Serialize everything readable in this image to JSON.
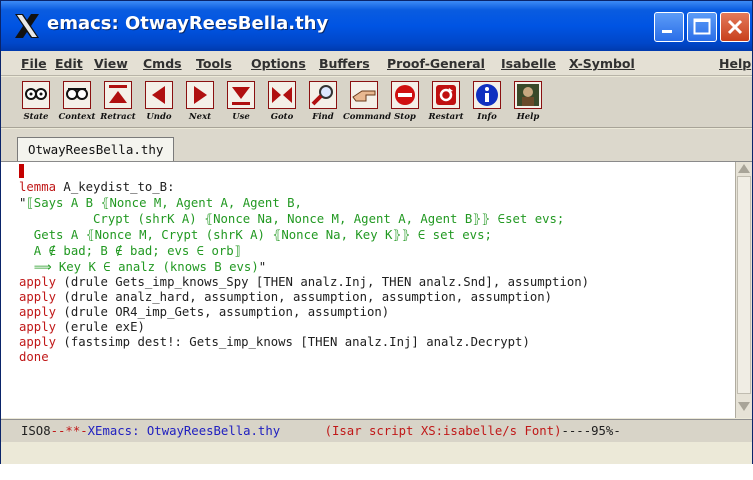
{
  "window": {
    "title": "emacs: OtwayReesBella.thy"
  },
  "menubar": {
    "items": [
      "File",
      "Edit",
      "View",
      "Cmds",
      "Tools",
      "Options",
      "Buffers",
      "Proof-General",
      "Isabelle",
      "X-Symbol"
    ],
    "help": "Help"
  },
  "toolbar": {
    "buttons": [
      {
        "label": "State",
        "icon": "glasses-icon"
      },
      {
        "label": "Context",
        "icon": "glasses-icon"
      },
      {
        "label": "Retract",
        "icon": "retract-icon"
      },
      {
        "label": "Undo",
        "icon": "undo-icon"
      },
      {
        "label": "Next",
        "icon": "next-icon"
      },
      {
        "label": "Use",
        "icon": "use-icon"
      },
      {
        "label": "Goto",
        "icon": "goto-icon"
      },
      {
        "label": "Find",
        "icon": "find-icon"
      },
      {
        "label": "Command",
        "icon": "command-icon"
      },
      {
        "label": "Stop",
        "icon": "stop-icon"
      },
      {
        "label": "Restart",
        "icon": "restart-icon"
      },
      {
        "label": "Info",
        "icon": "info-icon"
      },
      {
        "label": "Help",
        "icon": "help-icon"
      }
    ]
  },
  "tabs": {
    "active": "OtwayReesBella.thy"
  },
  "editor": {
    "lines": {
      "l1_kw": "lemma",
      "l1_rest": " A_keydist_to_B:",
      "l2_q": "\"",
      "l2_rest": "⟦Says A B ⦃Nonce M, Agent A, Agent B,",
      "l3": "          Crypt (shrK A) ⦃Nonce Na, Nonce M, Agent A, Agent B⦄⦄ ∈set evs;",
      "l4": "  Gets A ⦃Nonce M, Crypt (shrK A) ⦃Nonce Na, Key K⦄⦄ ∈ set evs;",
      "l5": "  A ∉ bad; B ∉ bad; evs ∈ orb⟧",
      "l6_rest": "  ⟹ Key K ∈ analz (knows B evs)",
      "l6_q": "\"",
      "l7_kw": "apply",
      "l7_rest": " (drule Gets_imp_knows_Spy [THEN analz.Inj, THEN analz.Snd], assumption)",
      "l8_kw": "apply",
      "l8_rest": " (drule analz_hard, assumption, assumption, assumption, assumption)",
      "l9_kw": "apply",
      "l9_rest": " (drule OR4_imp_Gets, assumption, assumption)",
      "l10_kw": "apply",
      "l10_rest": " (erule exE)",
      "l11_kw": "apply",
      "l11_rest": " (fastsimp dest!: Gets_imp_knows [THEN analz.Inj] analz.Decrypt)",
      "l12_kw": "done"
    }
  },
  "modeline": {
    "encoding": "ISO8",
    "status": "--**-",
    "buffer": "XEmacs: OtwayReesBella.thy",
    "gap": "      ",
    "mode": "(Isar script XS:isabelle/s Font)",
    "position": "----95%-"
  },
  "colors": {
    "keyword": "#c01818",
    "xsymbol_green": "#229922",
    "titlebar_blue": "#0054e3"
  }
}
